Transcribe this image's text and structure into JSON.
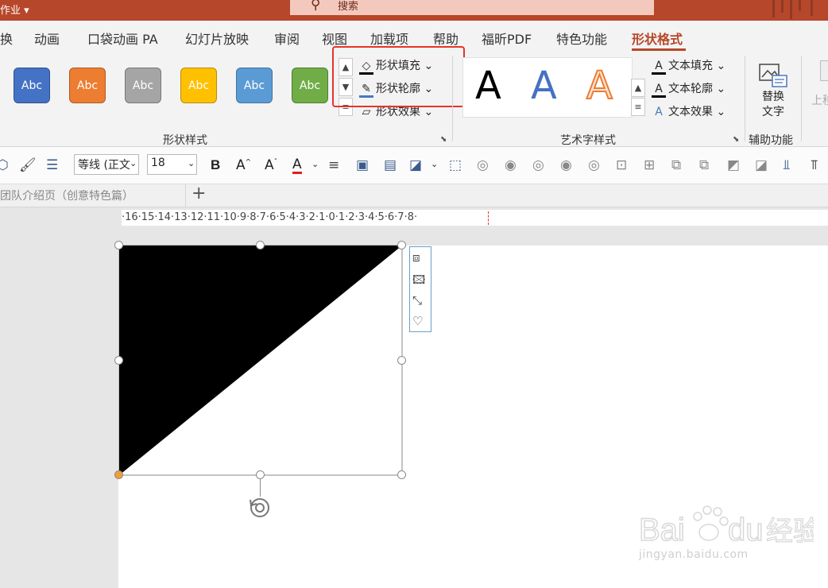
{
  "window": {
    "title": "作业",
    "search_label": "搜索"
  },
  "tabs": [
    "换",
    "动画",
    "口袋动画 PA",
    "幻灯片放映",
    "审阅",
    "视图",
    "加载项",
    "帮助",
    "福昕PDF",
    "特色功能",
    "形状格式"
  ],
  "ribbon": {
    "shape_styles": {
      "swatch_text": "Abc",
      "swatches": [
        "#4472c4",
        "#ed7d31",
        "#a5a5a5",
        "#ffc000",
        "#5b9bd5",
        "#70ad47"
      ],
      "fill": "形状填充",
      "outline": "形状轮廓",
      "effects": "形状效果",
      "label": "形状样式"
    },
    "wordart": {
      "letter": "A",
      "text_fill": "文本填充",
      "text_outline": "文本轮廓",
      "text_effects": "文本效果",
      "label": "艺术字样式"
    },
    "accessibility": {
      "alt_text_line1": "替换",
      "alt_text_line2": "文字",
      "label": "辅助功能"
    },
    "arrange_partial": "上移"
  },
  "toolbar": {
    "font_name": "等线 (正文",
    "font_size": "18"
  },
  "section_tab": "团队介绍页（创意特色篇）",
  "ruler_text": "·16·15·14·13·12·11·10·9·8·7·6·5·4·3·2·1·0·1·2·3·4·5·6·7·8·",
  "watermark": {
    "brand": "Bai",
    "brand_suffix": "du",
    "cn": "经验",
    "url": "jingyan.baidu.com"
  },
  "colors": {
    "accent": "#b7472a",
    "highlight": "#e5332b",
    "selection": "#8a8a8a",
    "adjust_handle": "#f0a030"
  }
}
